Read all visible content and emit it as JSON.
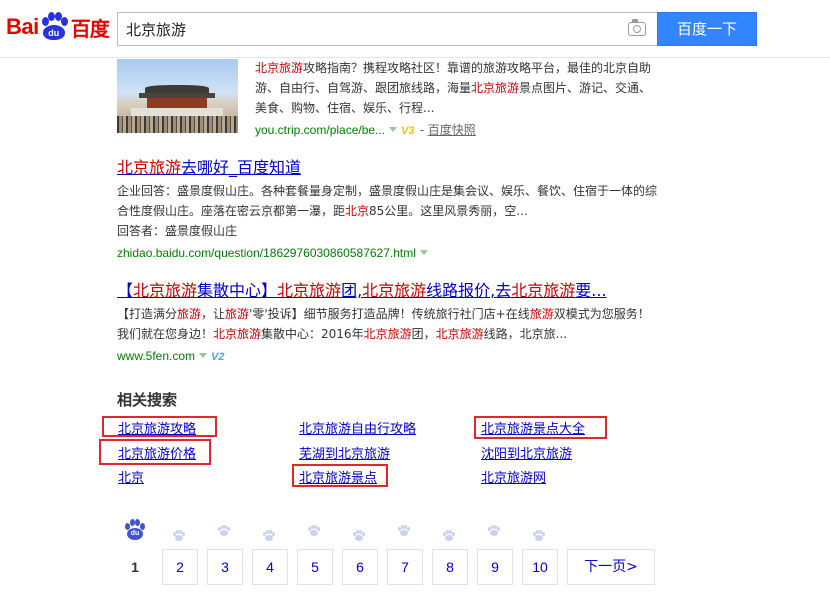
{
  "header": {
    "logo": {
      "left": "Bai",
      "paw": "du",
      "right": "百度"
    },
    "search_query": "北京旅游",
    "search_button": "百度一下"
  },
  "results": [
    {
      "snippet": [
        {
          "t": "北京旅游",
          "em": true
        },
        {
          "t": "攻略指南？携程攻略社区！靠谱的旅游攻略平台，最佳的北京自助游、自由行、自驾游、跟团旅线路，海量"
        },
        {
          "t": "北京旅游",
          "em": true
        },
        {
          "t": "景点图片、游记、交通、美食、购物、住宿、娱乐、行程..."
        }
      ],
      "url": "you.ctrip.com/place/be...",
      "badge": "V3",
      "cache": "百度快照"
    },
    {
      "title": [
        {
          "t": "北京旅游",
          "em": true
        },
        {
          "t": "去哪好_百度知道"
        }
      ],
      "snippet": [
        {
          "t": "企业回答：盛景度假山庄。各种套餐量身定制，盛景度假山庄是集会议、娱乐、餐饮、住宿于一体的综合性度假山庄。座落在密云京都第一瀑，距"
        },
        {
          "t": "北京",
          "em": true
        },
        {
          "t": "85公里。这里风景秀丽，空..."
        }
      ],
      "responder": "回答者：盛景度假山庄",
      "url": "zhidao.baidu.com/question/1862976030860587627.html"
    },
    {
      "title": [
        {
          "t": "【"
        },
        {
          "t": "北京旅游",
          "em": true
        },
        {
          "t": "集散中心】"
        },
        {
          "t": "北京旅游",
          "em": true
        },
        {
          "t": "团,"
        },
        {
          "t": "北京旅游",
          "em": true
        },
        {
          "t": "线路报价,去"
        },
        {
          "t": "北京旅游",
          "em": true
        },
        {
          "t": "要..."
        }
      ],
      "snippet": [
        {
          "t": "【打造满分"
        },
        {
          "t": "旅游",
          "em": true
        },
        {
          "t": "，让"
        },
        {
          "t": "旅游",
          "em": true
        },
        {
          "t": "'零'投诉】细节服务打造品牌！传统旅行社门店+在线"
        },
        {
          "t": "旅游",
          "em": true
        },
        {
          "t": "双模式为您服务！我们就在您身边！"
        },
        {
          "t": "北京旅游",
          "em": true
        },
        {
          "t": "集散中心：2016年"
        },
        {
          "t": "北京旅游",
          "em": true
        },
        {
          "t": "团，"
        },
        {
          "t": "北京旅游",
          "em": true
        },
        {
          "t": "线路，北京旅..."
        }
      ],
      "url": "www.5fen.com",
      "badge": "V2"
    }
  ],
  "related": {
    "title": "相关搜索",
    "links": [
      "北京旅游攻略",
      "北京旅游自由行攻略",
      "北京旅游景点大全",
      "北京旅游价格",
      "芜湖到北京旅游",
      "沈阳到北京旅游",
      "北京",
      "北京旅游景点",
      "北京旅游网"
    ]
  },
  "pagination": {
    "paw_label": "du",
    "current": "1",
    "pages": [
      "2",
      "3",
      "4",
      "5",
      "6",
      "7",
      "8",
      "9",
      "10"
    ],
    "next": "下一页>"
  },
  "colors": {
    "accent": "#3385ff",
    "highlight_box": "#e0272c",
    "keyword": "#cc0000",
    "link": "#0000cc",
    "url": "#008000"
  }
}
